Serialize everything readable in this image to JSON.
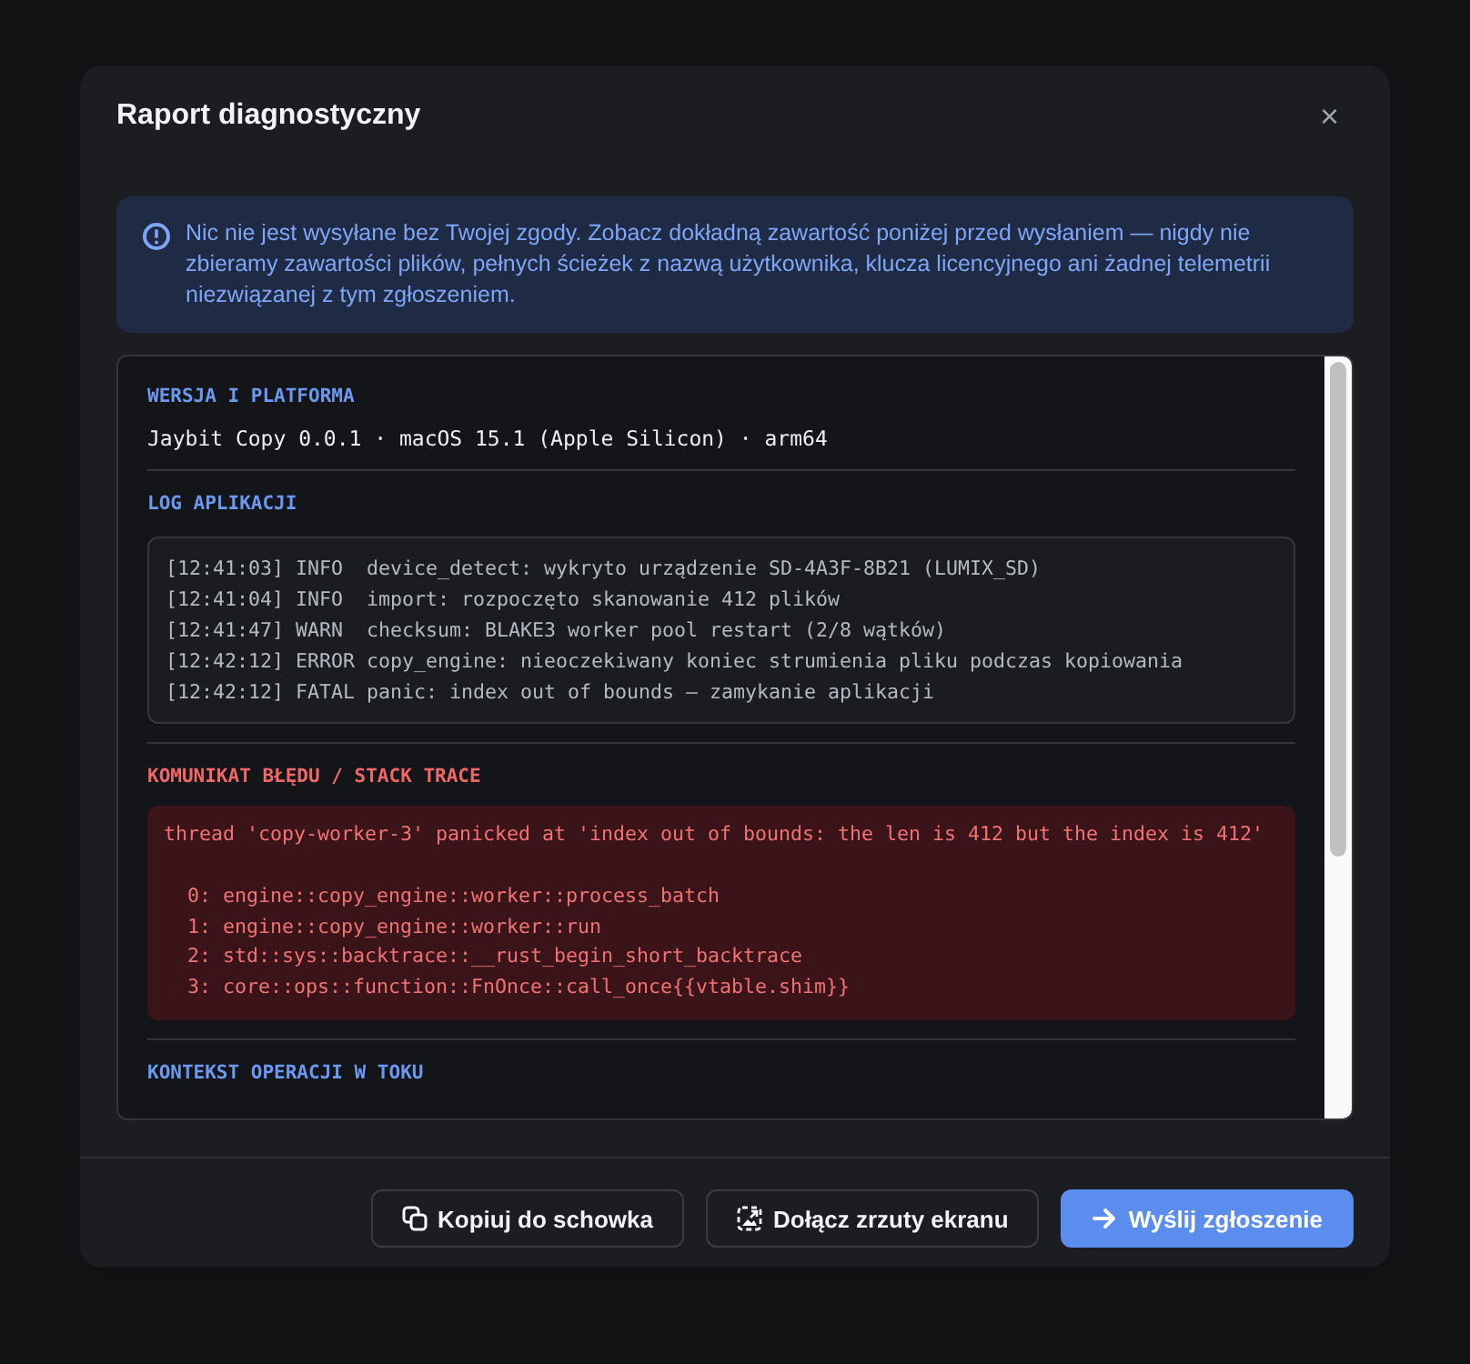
{
  "dialog": {
    "title": "Raport diagnostyczny",
    "close": "×"
  },
  "notice": {
    "text": "Nic nie jest wysyłane bez Twojej zgody. Zobacz dokładną zawartość poniżej przed wysłaniem — nigdy nie zbieramy zawartości plików, pełnych ścieżek z nazwą użytkownika, klucza licencyjnego ani żadnej telemetrii niezwiązanej z tym zgłoszeniem."
  },
  "sections": [
    {
      "kind": "text",
      "heading": "WERSJA I PLATFORMA",
      "text": "Jaybit Copy 0.0.1 · macOS 15.1 (Apple Silicon) · arm64"
    },
    {
      "kind": "log",
      "heading": "LOG APLIKACJI",
      "lines": [
        "[12:41:03] INFO  device_detect: wykryto urządzenie SD-4A3F-8B21 (LUMIX_SD)",
        "[12:41:04] INFO  import: rozpoczęto skanowanie 412 plików",
        "[12:41:47] WARN  checksum: BLAKE3 worker pool restart (2/8 wątków)",
        "[12:42:12] ERROR copy_engine: nieoczekiwany koniec strumienia pliku podczas kopiowania",
        "[12:42:12] FATAL panic: index out of bounds — zamykanie aplikacji"
      ]
    },
    {
      "kind": "error",
      "heading": "KOMUNIKAT BŁĘDU / STACK TRACE",
      "message": "thread 'copy-worker-3' panicked at 'index out of bounds: the len is 412 but the index is 412'",
      "frames": [
        "0: engine::copy_engine::worker::process_batch",
        "1: engine::copy_engine::worker::run",
        "2: std::sys::backtrace::__rust_begin_short_backtrace",
        "3: core::ops::function::FnOnce::call_once{{vtable.shim}}"
      ]
    },
    {
      "kind": "text",
      "heading": "KONTEKST OPERACJI W TOKU"
    }
  ],
  "buttons": [
    {
      "kind": "copy",
      "label": "Kopiuj do schowka"
    },
    {
      "kind": "attach",
      "label": "Dołącz zrzuty ekranu"
    },
    {
      "kind": "send",
      "label": "Wyślij zgłoszenie"
    }
  ]
}
